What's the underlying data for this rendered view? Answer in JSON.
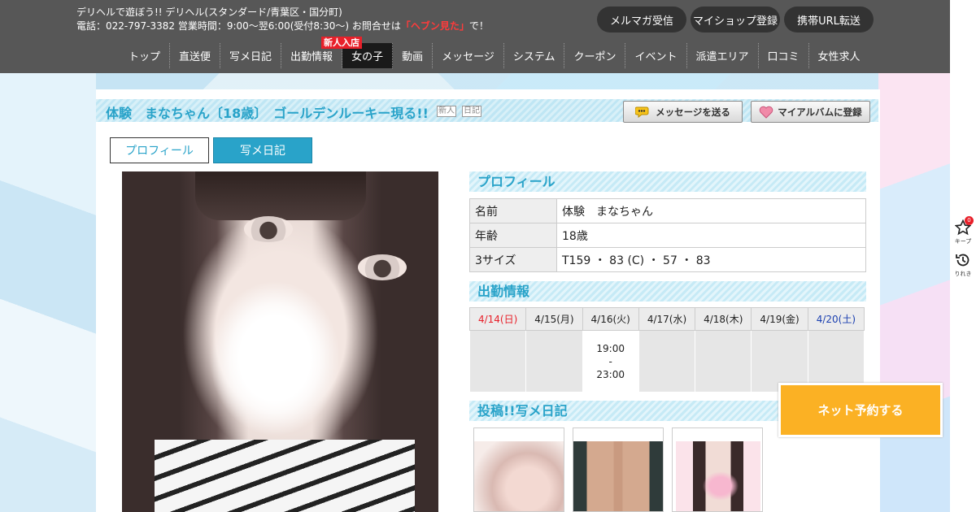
{
  "header": {
    "tagline": "デリヘルで遊ぼう!! デリヘル(スタンダード/青葉区・国分町)",
    "contact_prefix": "電話：022-797-3382 営業時間：9:00～翌6:00(受付8:30～) お問合せは",
    "contact_highlight": "「ヘブン見た」",
    "contact_suffix": "で！",
    "pills": [
      "メルマガ受信",
      "マイショップ登録",
      "携帯URL転送"
    ],
    "nav": [
      "トップ",
      "直送便",
      "写メ日記",
      "出勤情報",
      "女の子",
      "動画",
      "メッセージ",
      "システム",
      "クーポン",
      "イベント",
      "派遣エリア",
      "口コミ",
      "女性求人"
    ],
    "new_badge": "新人入店"
  },
  "title": {
    "text": "体験　まなちゃん〔18歳〕　ゴールデンルーキー現る!!",
    "tag_new": "新人",
    "tag_diary": "日記",
    "message_button": "メッセージを送る",
    "album_button": "マイアルバムに登録"
  },
  "tabs": {
    "profile": "プロフィール",
    "diary": "写メ日記"
  },
  "profile": {
    "heading": "プロフィール",
    "rows": [
      {
        "label": "名前",
        "value": "体験　まなちゃん"
      },
      {
        "label": "年齢",
        "value": "18歳"
      },
      {
        "label": "3サイズ",
        "value": "T159 ・ 83 (C) ・ 57 ・ 83"
      }
    ]
  },
  "schedule": {
    "heading": "出勤情報",
    "days": [
      "4/14(日)",
      "4/15(月)",
      "4/16(火)",
      "4/17(水)",
      "4/18(木)",
      "4/19(金)",
      "4/20(土)"
    ],
    "shift": {
      "start": "19:00",
      "sep": "-",
      "end": "23:00"
    }
  },
  "diary": {
    "heading": "投稿!!写メ日記"
  },
  "reserve_button": "ネット予約する",
  "sidebar": {
    "keep_label": "キープ",
    "keep_count": "0",
    "history_label": "りれき"
  },
  "colors": {
    "accent": "#29a3c9",
    "header_bg": "#575757",
    "reserve": "#fbb124",
    "sunday": "#e8202a",
    "saturday": "#1a3fb0"
  }
}
